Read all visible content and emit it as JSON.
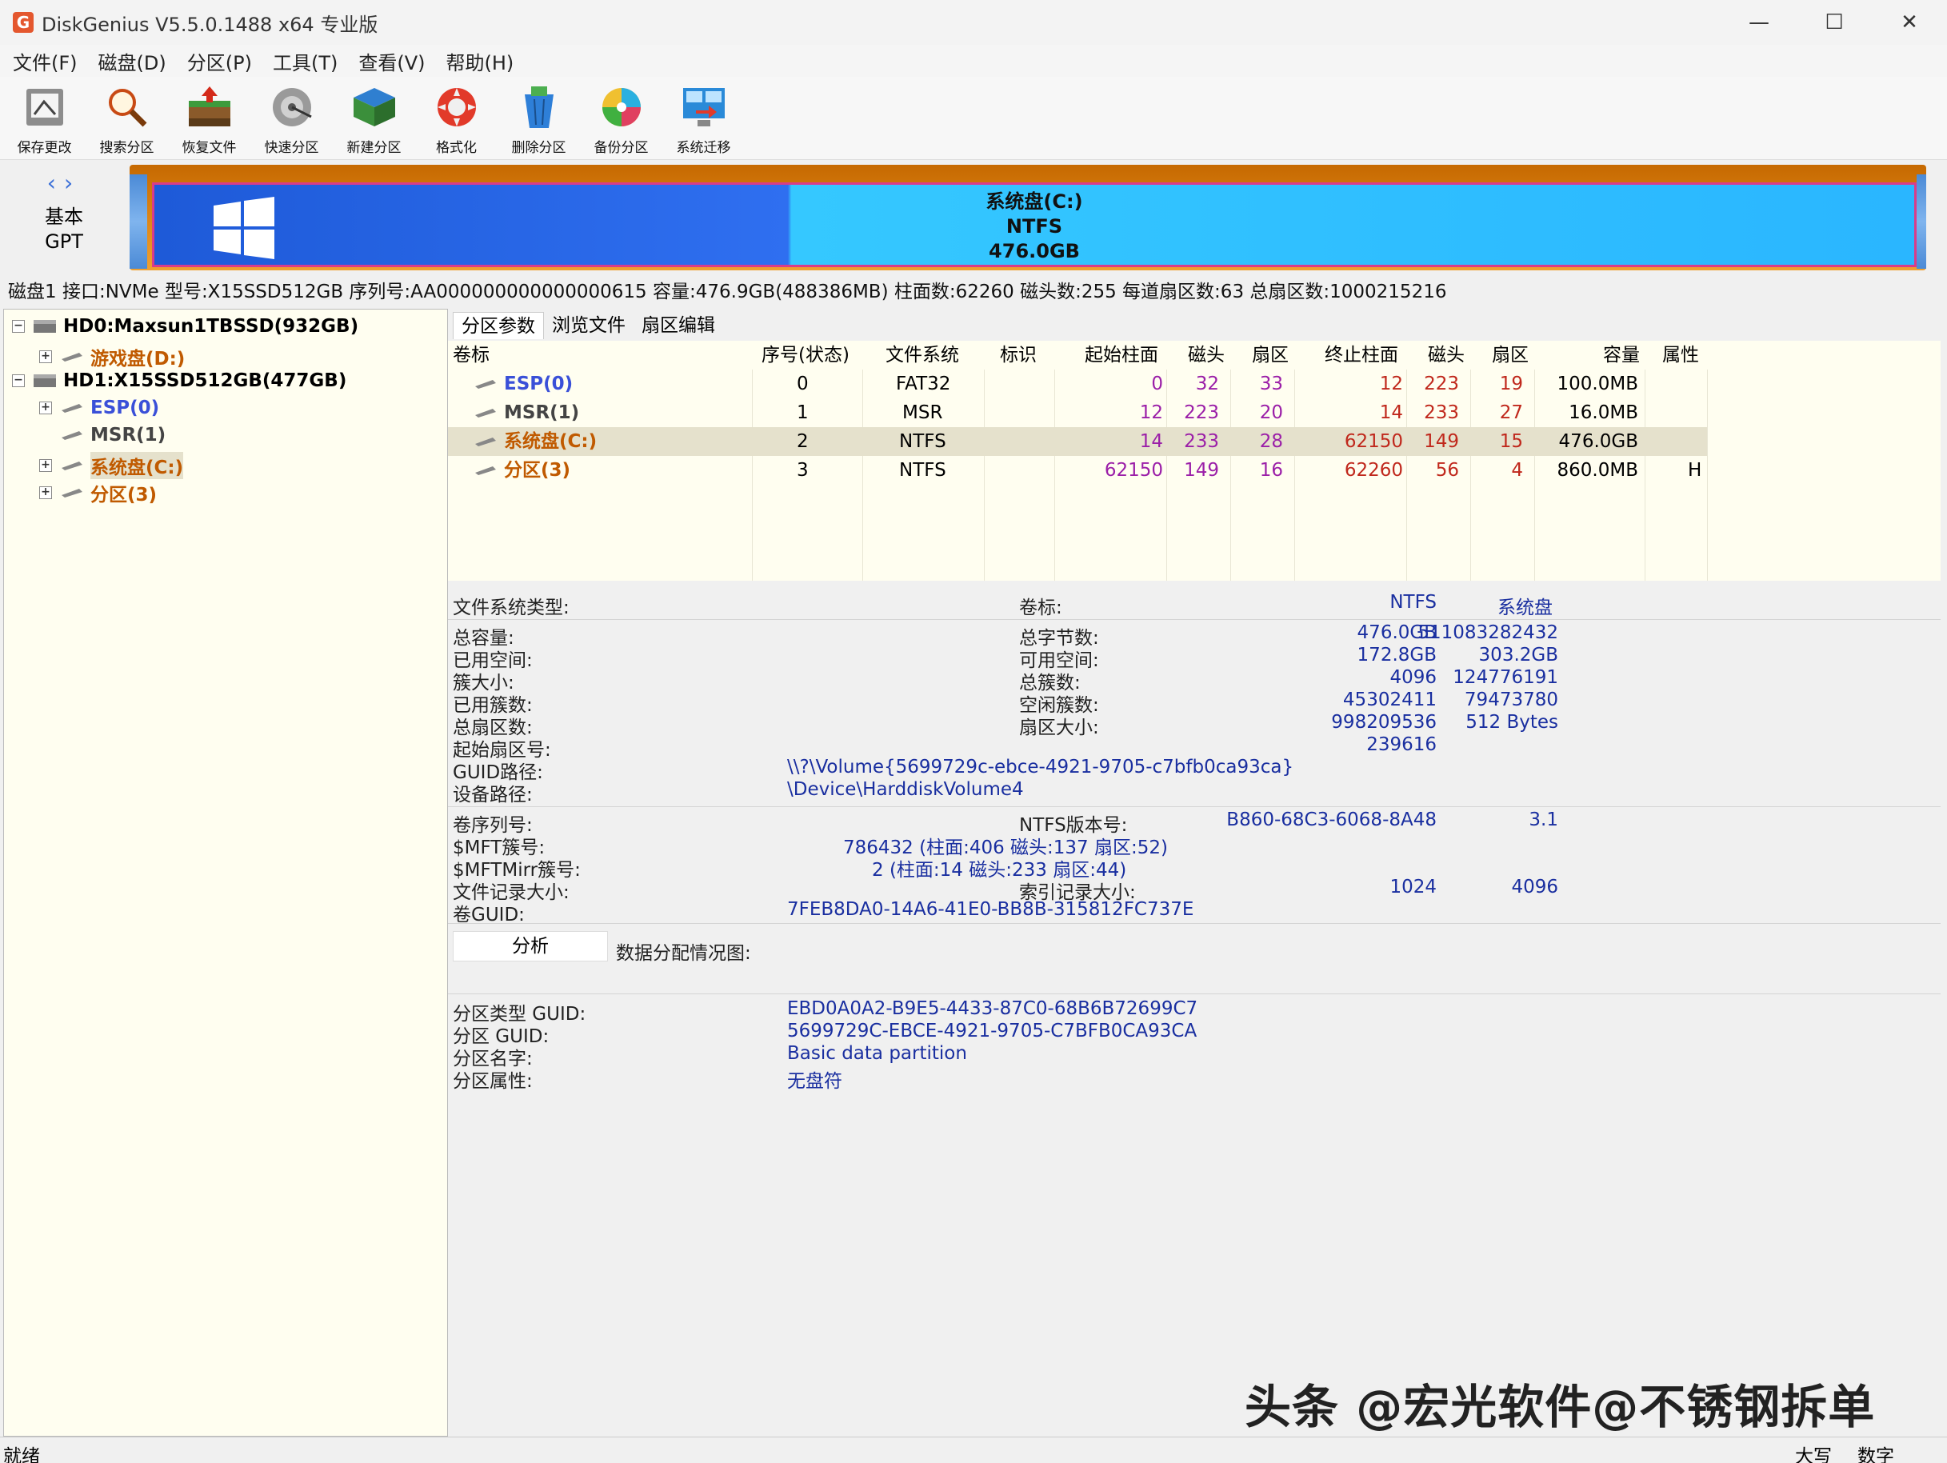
{
  "window": {
    "title": "DiskGenius V5.5.0.1488 x64 专业版",
    "app_icon": "G"
  },
  "menu": [
    "文件(F)",
    "磁盘(D)",
    "分区(P)",
    "工具(T)",
    "查看(V)",
    "帮助(H)"
  ],
  "toolbar": [
    {
      "label": "保存更改",
      "icon": "save-icon"
    },
    {
      "label": "搜索分区",
      "icon": "search-icon"
    },
    {
      "label": "恢复文件",
      "icon": "recover-icon"
    },
    {
      "label": "快速分区",
      "icon": "quick-partition-icon"
    },
    {
      "label": "新建分区",
      "icon": "new-partition-icon"
    },
    {
      "label": "格式化",
      "icon": "format-icon"
    },
    {
      "label": "删除分区",
      "icon": "delete-icon"
    },
    {
      "label": "备份分区",
      "icon": "backup-icon"
    },
    {
      "label": "系统迁移",
      "icon": "migrate-icon"
    }
  ],
  "disk_type": {
    "line1": "基本",
    "line2": "GPT"
  },
  "disk_map": {
    "name": "系统盘(C:)",
    "fs": "NTFS",
    "size": "476.0GB",
    "used_fraction": 0.363
  },
  "disk_info": "磁盘1 接口:NVMe  型号:X15SSD512GB  序列号:AA000000000000000615  容量:476.9GB(488386MB)  柱面数:62260  磁头数:255  每道扇区数:63  总扇区数:1000215216",
  "tree": {
    "disk0": "HD0:Maxsun1TBSSD(932GB)",
    "disk0_part": "游戏盘(D:)",
    "disk1": "HD1:X15SSD512GB(477GB)",
    "disk1_parts": [
      "ESP(0)",
      "MSR(1)",
      "系统盘(C:)",
      "分区(3)"
    ]
  },
  "tabs": [
    "分区参数",
    "浏览文件",
    "扇区编辑"
  ],
  "table": {
    "headers": [
      "卷标",
      "序号(状态)",
      "文件系统",
      "标识",
      "起始柱面",
      "磁头",
      "扇区",
      "终止柱面",
      "磁头",
      "扇区",
      "容量",
      "属性"
    ],
    "rows": [
      [
        "ESP(0)",
        "0",
        "FAT32",
        "",
        "0",
        "32",
        "33",
        "12",
        "223",
        "19",
        "100.0MB",
        ""
      ],
      [
        "MSR(1)",
        "1",
        "MSR",
        "",
        "12",
        "223",
        "20",
        "14",
        "233",
        "27",
        "16.0MB",
        ""
      ],
      [
        "系统盘(C:)",
        "2",
        "NTFS",
        "",
        "14",
        "233",
        "28",
        "62150",
        "149",
        "15",
        "476.0GB",
        ""
      ],
      [
        "分区(3)",
        "3",
        "NTFS",
        "",
        "62150",
        "149",
        "16",
        "62260",
        "56",
        "4",
        "860.0MB",
        "H"
      ]
    ]
  },
  "details": {
    "fs_type_label": "文件系统类型:",
    "fs_type": "NTFS",
    "vol_label_label": "卷标:",
    "vol_label": "系统盘",
    "total_label": "总容量:",
    "total": "476.0GB",
    "total_bytes_label": "总字节数:",
    "total_bytes": "511083282432",
    "used_label": "已用空间:",
    "used": "172.8GB",
    "free_label": "可用空间:",
    "free": "303.2GB",
    "cluster_label": "簇大小:",
    "cluster": "4096",
    "total_clusters_label": "总簇数:",
    "total_clusters": "124776191",
    "used_clusters_label": "已用簇数:",
    "used_clusters": "45302411",
    "free_clusters_label": "空闲簇数:",
    "free_clusters": "79473780",
    "total_sectors_label": "总扇区数:",
    "total_sectors": "998209536",
    "sector_size_label": "扇区大小:",
    "sector_size": "512 Bytes",
    "start_sector_label": "起始扇区号:",
    "start_sector": "239616",
    "guid_path_label": "GUID路径:",
    "guid_path": "\\\\?\\Volume{5699729c-ebce-4921-9705-c7bfb0ca93ca}",
    "device_path_label": "设备路径:",
    "device_path": "\\Device\\HarddiskVolume4",
    "vol_serial_label": "卷序列号:",
    "vol_serial": "B860-68C3-6068-8A48",
    "ntfs_ver_label": "NTFS版本号:",
    "ntfs_ver": "3.1",
    "mft_label": "$MFT簇号:",
    "mft": "786432 (柱面:406 磁头:137 扇区:52)",
    "mftmirr_label": "$MFTMirr簇号:",
    "mftmirr": "2 (柱面:14 磁头:233 扇区:44)",
    "record_size_label": "文件记录大小:",
    "record_size": "1024",
    "index_size_label": "索引记录大小:",
    "index_size": "4096",
    "vol_guid_label": "卷GUID:",
    "vol_guid": "7FEB8DA0-14A6-41E0-BB8B-315812FC737E",
    "analyze_button": "分析",
    "alloc_label": "数据分配情况图:",
    "ptype_guid_label": "分区类型 GUID:",
    "ptype_guid": "EBD0A0A2-B9E5-4433-87C0-68B6B72699C7",
    "pguid_label": "分区 GUID:",
    "pguid": "5699729C-EBCE-4921-9705-C7BFB0CA93CA",
    "pname_label": "分区名字:",
    "pname": "Basic data partition",
    "pattr_label": "分区属性:",
    "pattr": "无盘符"
  },
  "watermark": "头条 @宏光软件@不锈钢拆单",
  "status": {
    "left": "就绪",
    "caps": "大写",
    "num": "数字"
  },
  "colors": {
    "accent_blue": "#1a2fa0",
    "partition_orange": "#c05a00",
    "partition_blue": "#3a50d8",
    "numbers_purple": "#9b1fa8",
    "numbers_red": "#c0281c"
  }
}
